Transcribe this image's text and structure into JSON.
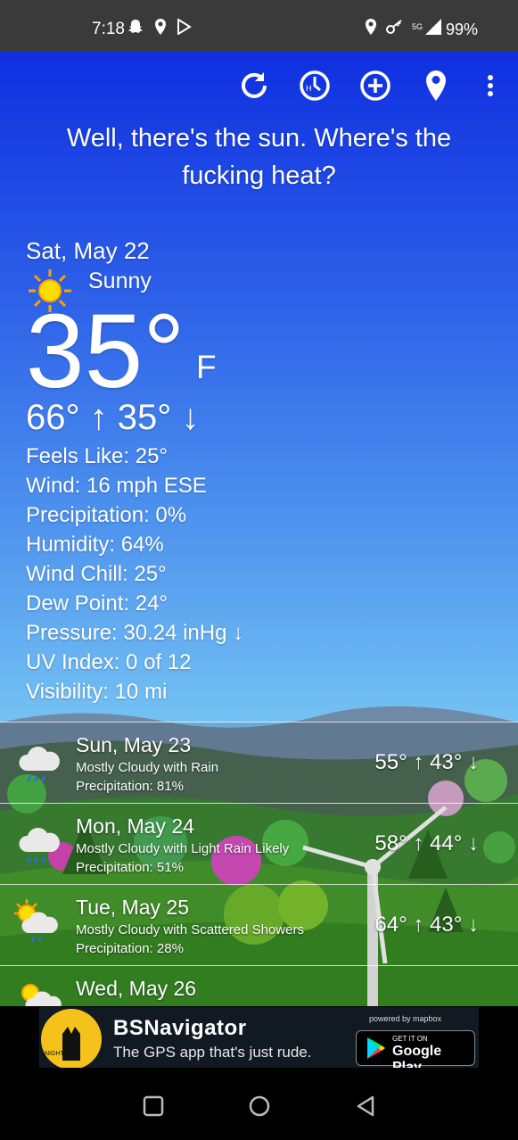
{
  "status_bar": {
    "time": "7:18",
    "battery": "99%",
    "network": "5G",
    "left_icons": [
      "snapchat-icon",
      "location-icon",
      "play-store-icon"
    ],
    "right_icons": [
      "location-icon",
      "vpn-key-icon",
      "signal-icon"
    ]
  },
  "toolbar": {
    "icons": [
      "refresh-icon",
      "history-icon",
      "add-location-icon",
      "location-pin-icon",
      "more-options-icon"
    ]
  },
  "quote": "Well, there's the sun. Where's the fucking heat?",
  "current": {
    "date": "Sat, May 22",
    "condition": "Sunny",
    "temp": "35°",
    "unit": "F",
    "hilo": "66° ↑ 35° ↓",
    "details": [
      "Feels Like: 25°",
      "Wind: 16 mph ESE",
      "Precipitation: 0%",
      "Humidity: 64%",
      "Wind Chill: 25°",
      "Dew Point: 24°",
      "Pressure: 30.24 inHg ↓",
      "UV Index: 0 of 12",
      "Visibility: 10 mi"
    ]
  },
  "forecast": [
    {
      "date": "Sun, May 23",
      "condition": "Mostly Cloudy with Rain",
      "precip": "Precipitation: 81%",
      "hilo": "55° ↑ 43° ↓",
      "icon": "cloud-rain-icon"
    },
    {
      "date": "Mon, May 24",
      "condition": "Mostly Cloudy with Light Rain Likely",
      "precip": "Precipitation: 51%",
      "hilo": "58° ↑ 44° ↓",
      "icon": "cloud-rain-icon"
    },
    {
      "date": "Tue, May 25",
      "condition": "Mostly Cloudy with Scattered Showers",
      "precip": "Precipitation: 28%",
      "hilo": "64° ↑ 43° ↓",
      "icon": "sun-cloud-rain-icon"
    },
    {
      "date": "Wed, May 26",
      "condition": "",
      "precip": "",
      "hilo": "",
      "icon": "sun-cloud-icon"
    }
  ],
  "ad": {
    "title": "BSNavigator",
    "tagline": "The GPS app that's just rude.",
    "logo_text": "NIGHT CAT",
    "powered_by": "powered by mapbox",
    "store_top": "GET IT ON",
    "store_name": "Google Play"
  },
  "nav_bar": {
    "buttons": [
      "recents-button",
      "home-button",
      "back-button"
    ]
  },
  "colors": {
    "sky_top": "#0f2fe0",
    "sky_bottom": "#8ad3f6",
    "grass": "#3f9a2c",
    "sun": "#ffc400"
  }
}
